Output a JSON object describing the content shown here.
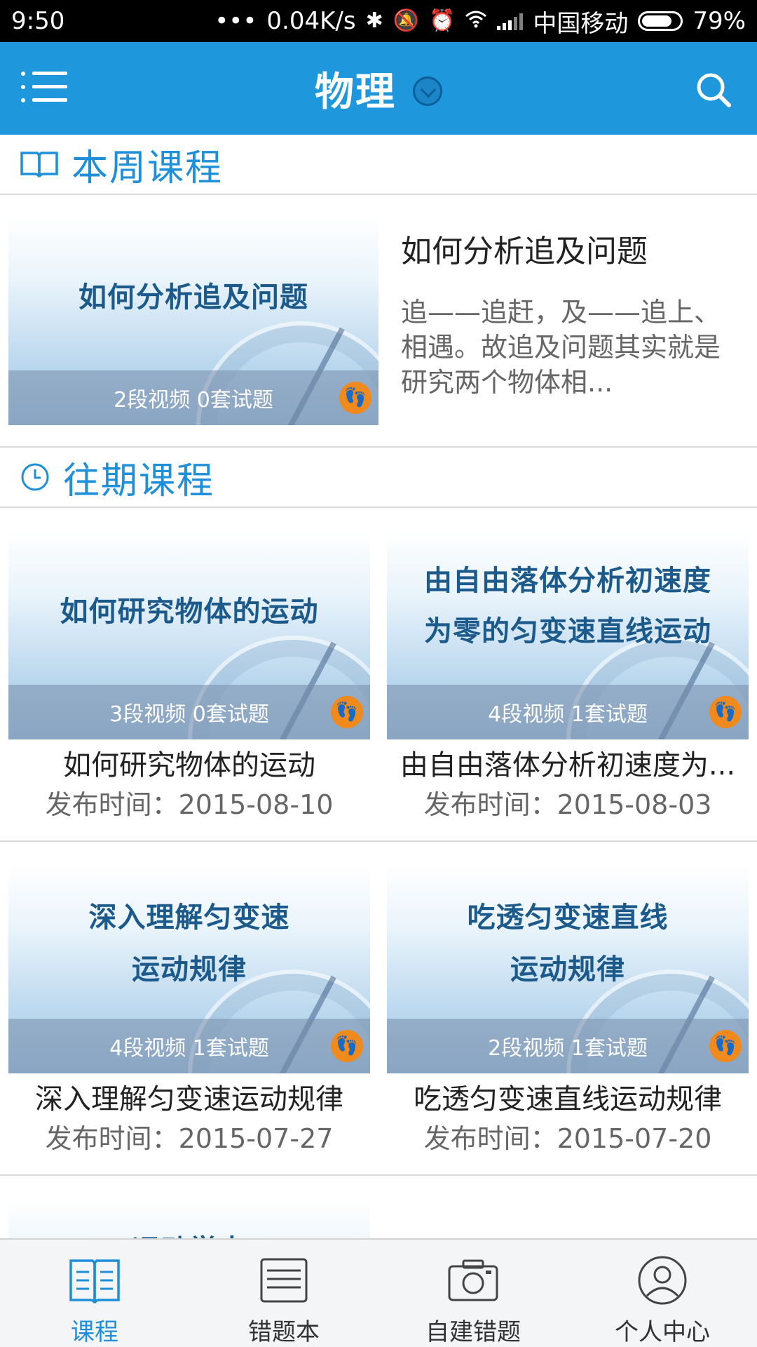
{
  "status_bar": {
    "time": "9:50",
    "dots": "•••",
    "net_speed": "0.04K/s",
    "carrier": "中国移动",
    "battery": "79%"
  },
  "header": {
    "title": "物理"
  },
  "this_week": {
    "heading": "本周课程",
    "course": {
      "thumb_title": "如何分析追及问题",
      "meta": "2段视频 0套试题",
      "title": "如何分析追及问题",
      "description": "追——追赶，及——追上、相遇。故追及问题其实就是研究两个物体相..."
    }
  },
  "past": {
    "heading": "往期课程",
    "courses": [
      {
        "thumb_line1": "如何研究物体的运动",
        "thumb_line2": "",
        "meta": "3段视频 0套试题",
        "title": "如何研究物体的运动",
        "date": "发布时间：2015-08-10"
      },
      {
        "thumb_line1": "由自由落体分析初速度",
        "thumb_line2": "为零的匀变速直线运动",
        "meta": "4段视频 1套试题",
        "title": "由自由落体分析初速度为...",
        "date": "发布时间：2015-08-03"
      },
      {
        "thumb_line1": "深入理解匀变速",
        "thumb_line2": "运动规律",
        "meta": "4段视频 1套试题",
        "title": "深入理解匀变速运动规律",
        "date": "发布时间：2015-07-27"
      },
      {
        "thumb_line1": "吃透匀变速直线",
        "thumb_line2": "运动规律",
        "meta": "2段视频 1套试题",
        "title": "吃透匀变速直线运动规律",
        "date": "发布时间：2015-07-20"
      },
      {
        "thumb_line1": "运动学人",
        "thumb_line2": ""
      }
    ]
  },
  "bottom_nav": {
    "items": [
      {
        "label": "课程",
        "icon": "book-icon",
        "active": true
      },
      {
        "label": "错题本",
        "icon": "notebook-icon",
        "active": false
      },
      {
        "label": "自建错题",
        "icon": "camera-icon",
        "active": false
      },
      {
        "label": "个人中心",
        "icon": "user-icon",
        "active": false
      }
    ]
  },
  "colors": {
    "accent": "#1e97dc",
    "badge": "#f08a1d"
  }
}
